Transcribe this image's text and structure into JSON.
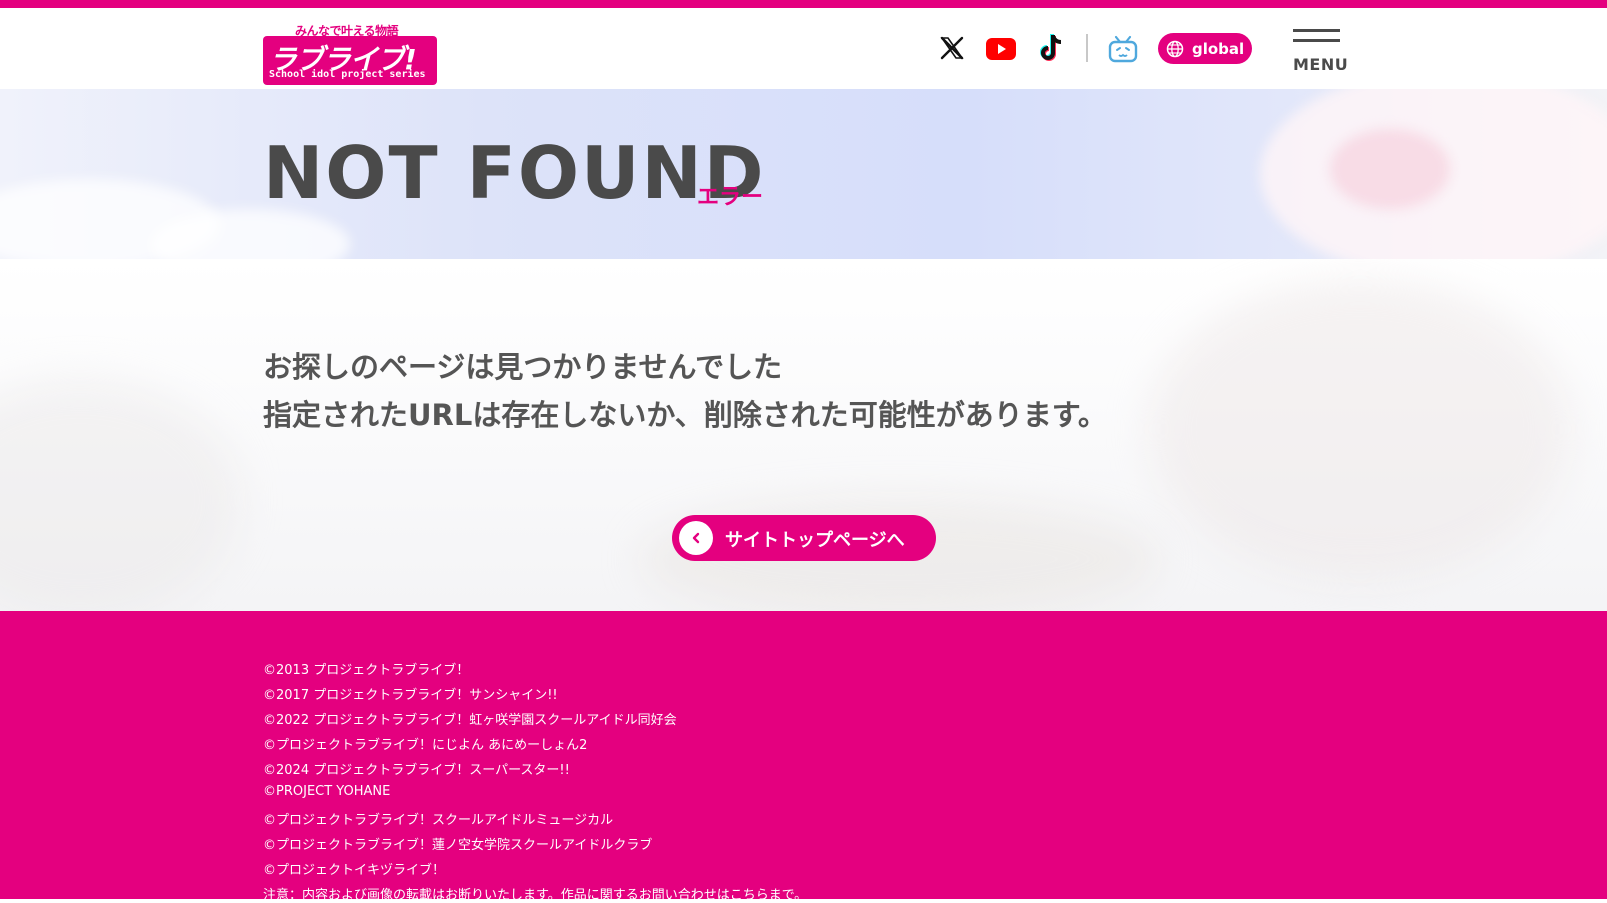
{
  "header": {
    "logo_tagline": "みんなで叶える物語",
    "logo_main": "ラブライブ!",
    "logo_sub": "School idol project series",
    "global_label": "global",
    "menu_label": "MENU",
    "social_icons": [
      "x-icon",
      "youtube-icon",
      "tiktok-icon",
      "bilibili-icon"
    ]
  },
  "hero": {
    "title": "NOT FOUND",
    "subtitle": "エラー"
  },
  "main": {
    "message_line1": "お探しのページは見つかりませんでした",
    "message_line2": "指定されたURLは存在しないか、削除された可能性があります。",
    "back_button": "サイトトップページへ"
  },
  "footer": {
    "copyrights": [
      "©2013 プロジェクトラブライブ！",
      "©2017 プロジェクトラブライブ！サンシャイン!!",
      "©2022 プロジェクトラブライブ！虹ヶ咲学園スクールアイドル同好会",
      "©プロジェクトラブライブ！にじよん あにめーしょん2",
      "©2024 プロジェクトラブライブ！スーパースター!!",
      "©PROJECT YOHANE",
      "©プロジェクトラブライブ！スクールアイドルミュージカル",
      "©プロジェクトラブライブ！蓮ノ空女学院スクールアイドルクラブ",
      "©プロジェクトイキヅライブ！",
      "注意：内容および画像の転載はお断りいたします。作品に関するお問い合わせはこちらまで。"
    ]
  },
  "colors": {
    "brand_pink": "#e4007f",
    "text_gray": "#4a4a4a",
    "youtube_red": "#ff0000",
    "bilibili_blue": "#4fa8dd"
  }
}
